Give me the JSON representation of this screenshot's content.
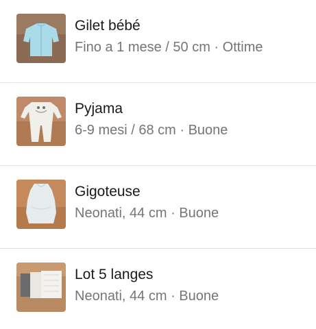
{
  "items": [
    {
      "title": "Gilet bébé",
      "subtitle": "Fino a 1 mese / 50 cm · Ottime",
      "thumb_icon": "blue-baby-cardigan-photo"
    },
    {
      "title": "Pyjama",
      "subtitle": "6-9 mesi / 68 cm · Buone",
      "thumb_icon": "white-baby-pyjama-photo"
    },
    {
      "title": "Gigoteuse",
      "subtitle": "Neonati, 44 cm · Buone",
      "thumb_icon": "sleeping-bag-photo"
    },
    {
      "title": "Lot 5 langes",
      "subtitle": "Neonati, 44 cm · Buone",
      "thumb_icon": "muslin-cloths-photo"
    }
  ]
}
